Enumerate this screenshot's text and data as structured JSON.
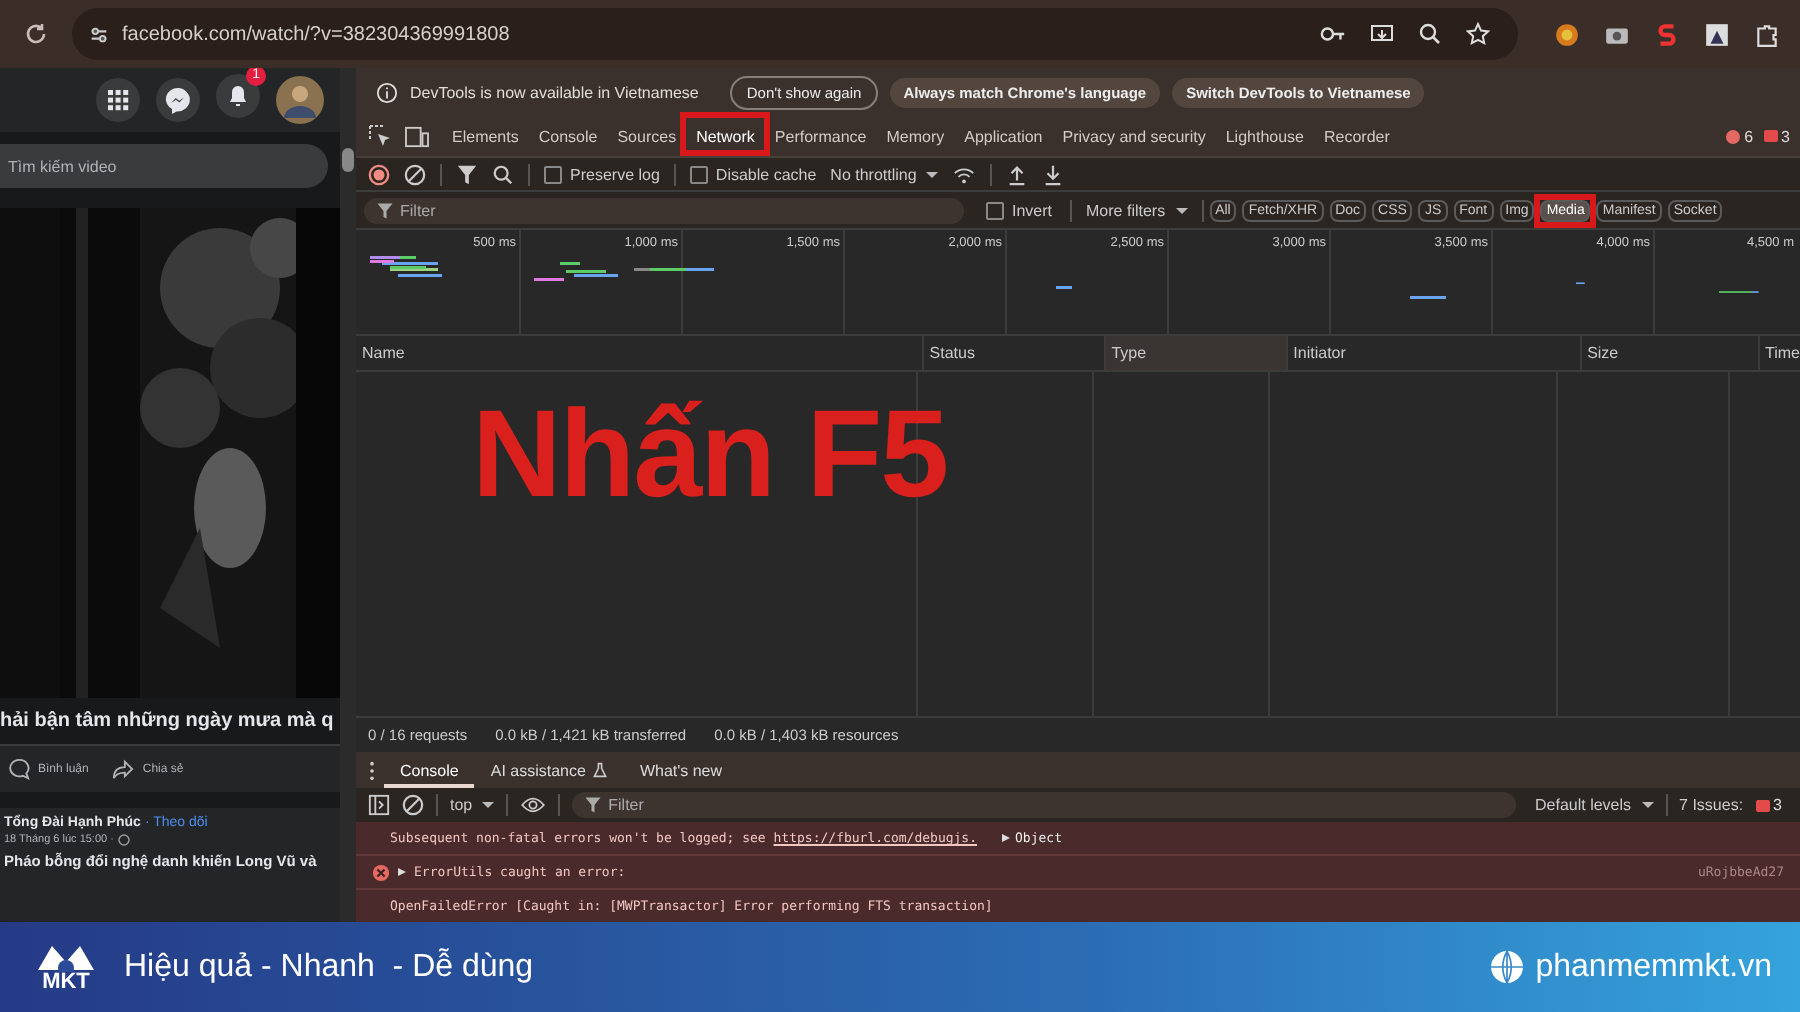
{
  "browser": {
    "url": "facebook.com/watch/?v=382304369991808"
  },
  "facebook": {
    "notification_count": "1",
    "search": {
      "placeholder": "Tìm kiếm video"
    },
    "video": {
      "kind": "picture"
    },
    "video_title": "hải bận tâm những ngày mưa mà q",
    "actions": [
      "Bình luận",
      "Chia sẻ"
    ],
    "post": {
      "author": "Tổng Đài Hạnh Phúc",
      "follow": "· Theo dõi",
      "date": "18 Tháng 6 lúc 15:00 ·",
      "text": "Pháo bỗng đổi nghệ danh khiến Long Vũ và"
    }
  },
  "devtools": {
    "infobar": {
      "message": "DevTools is now available in Vietnamese",
      "buttons": [
        "Don't show again",
        "Always match Chrome's language",
        "Switch DevTools to Vietnamese"
      ]
    },
    "tabs": [
      {
        "label": "Elements",
        "selected": false,
        "highlighted": false
      },
      {
        "label": "Console",
        "selected": false,
        "highlighted": false
      },
      {
        "label": "Sources",
        "selected": false,
        "highlighted": false
      },
      {
        "label": "Network",
        "selected": true,
        "highlighted": true
      },
      {
        "label": "Performance",
        "selected": false,
        "highlighted": false
      },
      {
        "label": "Memory",
        "selected": false,
        "highlighted": false
      },
      {
        "label": "Application",
        "selected": false,
        "highlighted": false
      },
      {
        "label": "Privacy and security",
        "selected": false,
        "highlighted": false
      },
      {
        "label": "Lighthouse",
        "selected": false,
        "highlighted": false
      },
      {
        "label": "Recorder",
        "selected": false,
        "highlighted": false
      }
    ],
    "error_count": "6",
    "warning_count": "3",
    "toolbar": {
      "preserve_log": {
        "label": "Preserve log",
        "checked": false
      },
      "disable_cache": {
        "label": "Disable cache",
        "checked": false
      },
      "throttling": "No throttling"
    },
    "filter": {
      "placeholder": "Filter",
      "invert": {
        "label": "Invert",
        "checked": false
      },
      "more_filters": "More filters",
      "types": [
        {
          "label": "All",
          "selected": false,
          "highlighted": false
        },
        {
          "label": "Fetch/XHR",
          "selected": false,
          "highlighted": false
        },
        {
          "label": "Doc",
          "selected": false,
          "highlighted": false
        },
        {
          "label": "CSS",
          "selected": false,
          "highlighted": false
        },
        {
          "label": "JS",
          "selected": false,
          "highlighted": false
        },
        {
          "label": "Font",
          "selected": false,
          "highlighted": false
        },
        {
          "label": "Img",
          "selected": false,
          "highlighted": false
        },
        {
          "label": "Media",
          "selected": true,
          "highlighted": true
        },
        {
          "label": "Manifest",
          "selected": false,
          "highlighted": false
        },
        {
          "label": "Socket",
          "selected": false,
          "highlighted": false
        }
      ]
    },
    "timeline_ticks": [
      "500 ms",
      "1,000 ms",
      "1,500 ms",
      "2,000 ms",
      "2,500 ms",
      "3,000 ms",
      "3,500 ms",
      "4,000 ms",
      "4,500 m"
    ],
    "columns": [
      {
        "label": "Name",
        "selected": false
      },
      {
        "label": "Status",
        "selected": false
      },
      {
        "label": "Type",
        "selected": true
      },
      {
        "label": "Initiator",
        "selected": false
      },
      {
        "label": "Size",
        "selected": false
      },
      {
        "label": "Time",
        "selected": false
      }
    ],
    "summary": [
      "0 / 16 requests",
      "0.0 kB / 1,421 kB transferred",
      "0.0 kB / 1,403 kB resources"
    ],
    "drawer_tabs": [
      {
        "label": "Console",
        "selected": true,
        "kind": "plain"
      },
      {
        "label": "AI assistance",
        "selected": false,
        "kind": "lab"
      },
      {
        "label": "What's new",
        "selected": false,
        "kind": "plain"
      }
    ],
    "console_bar": {
      "context": "top",
      "placeholder": "Filter",
      "levels": "Default levels",
      "issues": "7 Issues:",
      "issue_count": "3"
    },
    "messages": [
      {
        "kind": "plain",
        "text": "Subsequent non-fatal errors won't be logged; see ",
        "link": "https://fburl.com/debugjs.",
        "object": "Object"
      },
      {
        "kind": "error",
        "text": "ErrorUtils caught an error:",
        "source": "uRojbbeAd27"
      },
      {
        "kind": "plain",
        "text": "OpenFailedError [Caught in: [MWPTransactor] Error performing FTS transaction]"
      }
    ],
    "annotation": "Nhấn F5"
  },
  "banner": {
    "logo": "MKT",
    "slogan": "Hiệu quả - Nhanh  - Dễ dùng",
    "website": "phanmemmkt.vn"
  }
}
